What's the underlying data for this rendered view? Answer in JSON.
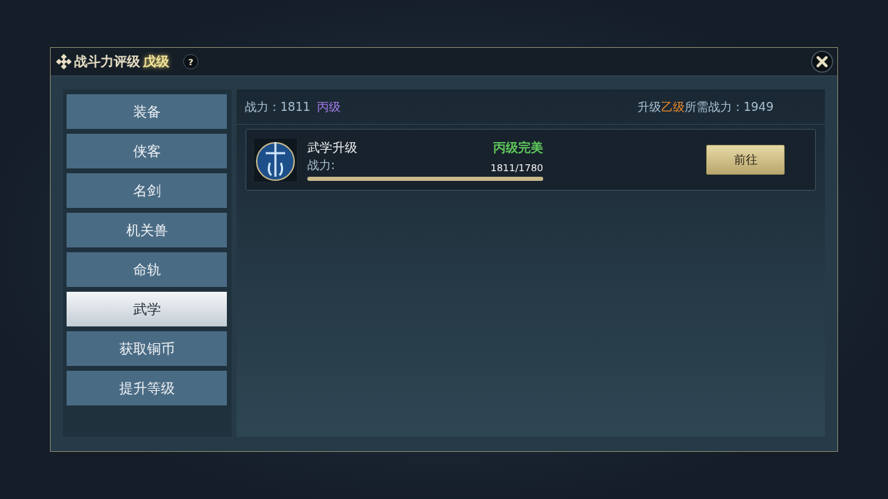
{
  "window": {
    "title": "战斗力评级",
    "grade": "戊级",
    "help": "?"
  },
  "sidebar": {
    "items": [
      {
        "label": "装备",
        "selected": false
      },
      {
        "label": "侠客",
        "selected": false
      },
      {
        "label": "名剑",
        "selected": false
      },
      {
        "label": "机关兽",
        "selected": false
      },
      {
        "label": "命轨",
        "selected": false
      },
      {
        "label": "武学",
        "selected": true
      },
      {
        "label": "获取铜币",
        "selected": false
      },
      {
        "label": "提升等级",
        "selected": false
      }
    ]
  },
  "header": {
    "power": "战力：1811",
    "grade": "丙级",
    "next_prefix": "升级",
    "next_grade": "乙级",
    "next_suffix": "所需战力：1949"
  },
  "tasks": [
    {
      "title": "武学升级",
      "status": "丙级完美",
      "label": "战力:",
      "progress": "1811/1780",
      "level": 1,
      "button": "前往"
    }
  ]
}
